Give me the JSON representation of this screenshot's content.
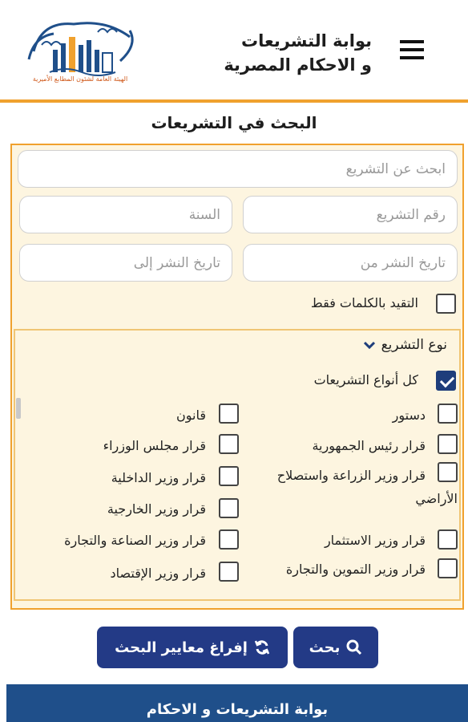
{
  "header": {
    "title_line1": "بوابة التشريعات",
    "title_line2": "و الاحكام المصرية",
    "logo_caption": "الهيئة العامة لشئون المطابع الأميرية"
  },
  "search": {
    "title": "البحث في التشريعات",
    "keyword_placeholder": "ابحث عن التشريع",
    "number_placeholder": "رقم التشريع",
    "year_placeholder": "السنة",
    "date_from_placeholder": "تاريخ النشر من",
    "date_to_placeholder": "تاريخ النشر إلى",
    "exact_words_label": "التقيد بالكلمات فقط"
  },
  "legislation_types": {
    "header": "نوع التشريع",
    "all_label": "كل أنواع التشريعات",
    "types": [
      "دستور",
      "قانون",
      "قرار رئيس الجمهورية",
      "قرار مجلس الوزراء",
      "قرار وزير الزراعة واستصلاح",
      "الأراضي",
      "قرار وزير الداخلية",
      "قرار وزير الخارجية",
      "قرار وزير الاستثمار",
      "قرار وزير الصناعة والتجارة",
      "قرار وزير التموين والتجارة",
      "قرار وزير الإقتصاد"
    ]
  },
  "buttons": {
    "search": "بحث",
    "clear": "إفراغ معايير البحث"
  },
  "footer": {
    "title": "بوابة التشريعات و الاحكام"
  },
  "colors": {
    "accent": "#f0a12e",
    "primary": "#233a86",
    "footer": "#1f4f8a",
    "panel": "#fdf5e0"
  }
}
